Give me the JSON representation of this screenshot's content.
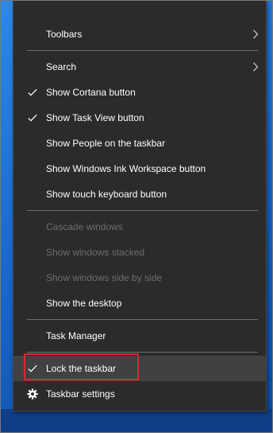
{
  "menu": {
    "items": [
      {
        "label": "Toolbars",
        "checked": false,
        "disabled": false,
        "submenu": true
      },
      {
        "label": "Search",
        "checked": false,
        "disabled": false,
        "submenu": true
      },
      {
        "label": "Show Cortana button",
        "checked": true,
        "disabled": false,
        "submenu": false
      },
      {
        "label": "Show Task View button",
        "checked": true,
        "disabled": false,
        "submenu": false
      },
      {
        "label": "Show People on the taskbar",
        "checked": false,
        "disabled": false,
        "submenu": false
      },
      {
        "label": "Show Windows Ink Workspace button",
        "checked": false,
        "disabled": false,
        "submenu": false
      },
      {
        "label": "Show touch keyboard button",
        "checked": false,
        "disabled": false,
        "submenu": false
      },
      {
        "label": "Cascade windows",
        "checked": false,
        "disabled": true,
        "submenu": false
      },
      {
        "label": "Show windows stacked",
        "checked": false,
        "disabled": true,
        "submenu": false
      },
      {
        "label": "Show windows side by side",
        "checked": false,
        "disabled": true,
        "submenu": false
      },
      {
        "label": "Show the desktop",
        "checked": false,
        "disabled": false,
        "submenu": false
      },
      {
        "label": "Task Manager",
        "checked": false,
        "disabled": false,
        "submenu": false
      },
      {
        "label": "Lock the taskbar",
        "checked": true,
        "disabled": false,
        "submenu": false,
        "highlighted": true
      },
      {
        "label": "Taskbar settings",
        "checked": false,
        "disabled": false,
        "submenu": false,
        "icon": "gear-icon"
      }
    ]
  },
  "colors": {
    "menu_background": "#2b2b2b",
    "text": "#ffffff",
    "disabled_text": "#6d6d6d",
    "hover_background": "#414141",
    "callout_border": "#e0262e",
    "desktop": "#1a74d6"
  }
}
